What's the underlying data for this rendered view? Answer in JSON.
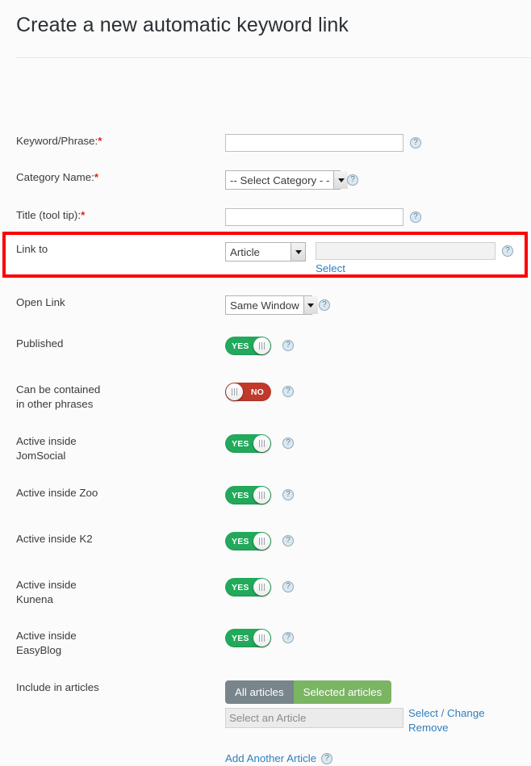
{
  "page": {
    "title": "Create a new automatic keyword link",
    "help_icon_glyph": "?",
    "help_icon_name": "help-question-icon",
    "accent_link_color": "#2f7fc1",
    "highlight_color": "#fb0000",
    "toggle_on_color": "#22a95b",
    "toggle_off_color": "#c0392b",
    "btn_grey_color": "#78858b",
    "btn_green_color": "#7ab563"
  },
  "fields": {
    "keyword": {
      "label": "Keyword/Phrase:",
      "required_mark": "*",
      "value": "",
      "placeholder": ""
    },
    "category": {
      "label": "Category Name:",
      "required_mark": "*",
      "selected": "-- Select Category - -"
    },
    "title_tooltip": {
      "label": "Title (tool tip):",
      "required_mark": "*",
      "value": "",
      "placeholder": ""
    },
    "link_to": {
      "label": "Link to",
      "selected": "Article",
      "target_value": "",
      "target_placeholder": "",
      "select_link": "Select"
    },
    "open_link": {
      "label": "Open Link",
      "selected": "Same Window"
    },
    "published": {
      "label": "Published",
      "state": "on",
      "state_label": "YES"
    },
    "can_be_contained": {
      "label_line1": "Can be contained",
      "label_line2": "in other phrases",
      "state": "off",
      "state_label": "NO"
    },
    "active_jomsocial": {
      "label_line1": "Active inside",
      "label_line2": "JomSocial",
      "state": "on",
      "state_label": "YES"
    },
    "active_zoo": {
      "label_line1": "Active inside Zoo",
      "label_line2": "",
      "state": "on",
      "state_label": "YES"
    },
    "active_k2": {
      "label_line1": "Active inside K2",
      "label_line2": "",
      "state": "on",
      "state_label": "YES"
    },
    "active_kunena": {
      "label_line1": "Active inside",
      "label_line2": "Kunena",
      "state": "on",
      "state_label": "YES"
    },
    "active_easyblog": {
      "label_line1": "Active inside",
      "label_line2": "EasyBlog",
      "state": "on",
      "state_label": "YES"
    },
    "include_in_articles": {
      "label": "Include in articles",
      "btn_all": "All articles",
      "btn_selected": "Selected articles",
      "article_value": "",
      "article_placeholder": "Select an Article",
      "link_select_change": "Select / Change",
      "link_remove": "Remove",
      "link_add_another": "Add Another Article"
    }
  }
}
